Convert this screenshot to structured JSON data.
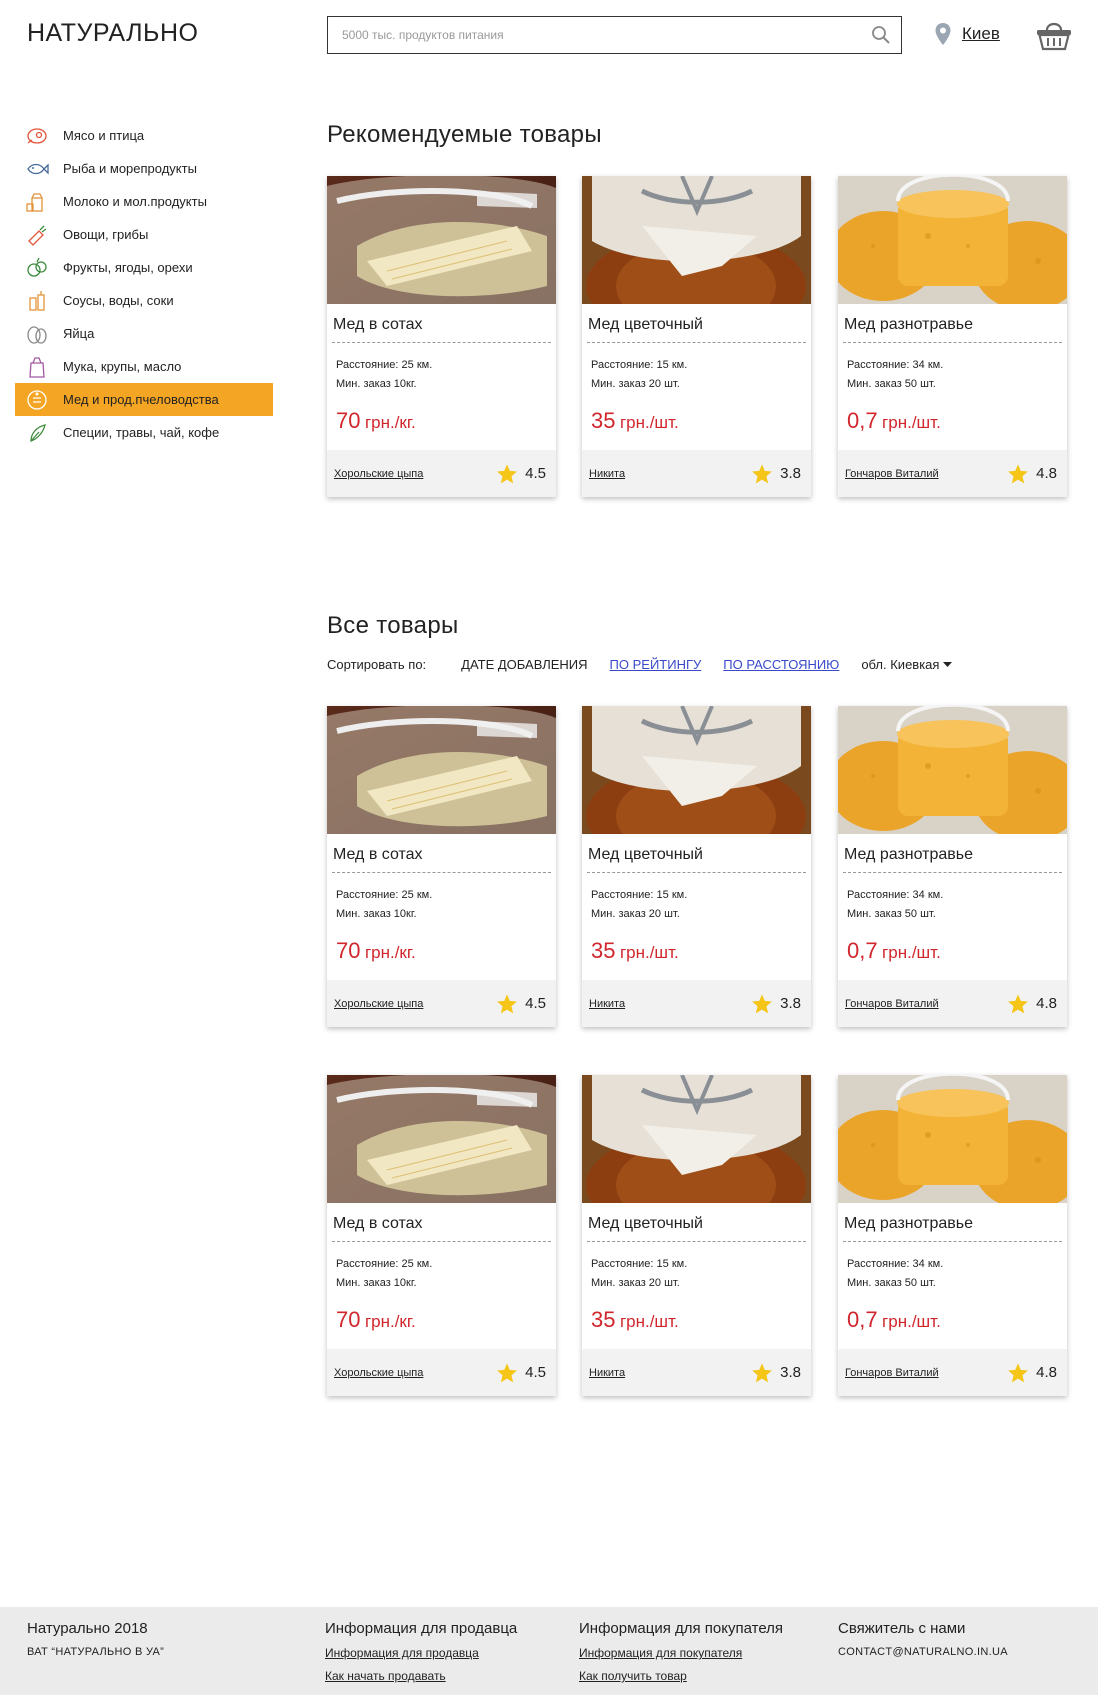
{
  "header": {
    "logo": "НАТУРАЛЬНО",
    "search_placeholder": "5000 тыс. продуктов питания",
    "city": "Киев"
  },
  "sidebar": {
    "items": [
      {
        "label": "Мясо и птица",
        "icon": "meat-icon",
        "active": false
      },
      {
        "label": "Рыба и морепродукты",
        "icon": "fish-icon",
        "active": false
      },
      {
        "label": "Молоко и мол.продукты",
        "icon": "milk-icon",
        "active": false
      },
      {
        "label": "Овощи, грибы",
        "icon": "vegetables-icon",
        "active": false
      },
      {
        "label": "Фрукты, ягоды, орехи",
        "icon": "fruits-icon",
        "active": false
      },
      {
        "label": "Соусы, воды, соки",
        "icon": "drinks-icon",
        "active": false
      },
      {
        "label": "Яйца",
        "icon": "eggs-icon",
        "active": false
      },
      {
        "label": "Мука, крупы, масло",
        "icon": "flour-icon",
        "active": false
      },
      {
        "label": "Мед и прод.пчеловодства",
        "icon": "honey-icon",
        "active": true
      },
      {
        "label": "Специи, травы, чай, кофе",
        "icon": "herbs-icon",
        "active": false
      }
    ]
  },
  "recommended": {
    "title": "Рекомендуемые товары"
  },
  "all": {
    "title": "Все товары",
    "sort_label": "Сортировать по:",
    "sort_options": [
      "дате добавления",
      "по рейтингу",
      "по расстоянию"
    ],
    "region": "обл. Киевкая"
  },
  "products": [
    {
      "name": "Мед в сотах",
      "distance": "Расстояние: 25 км.",
      "min_order": "Мин. заказ 10кг.",
      "price": "70",
      "unit": "грн./кг.",
      "seller": "Хорольские цыпа",
      "rating": "4.5",
      "image": "honeycomb-bucket"
    },
    {
      "name": "Мед цветочный",
      "distance": "Расстояние: 15 км.",
      "min_order": "Мин. заказ 20 шт.",
      "price": "35",
      "unit": "грн./шт.",
      "seller": "Никита",
      "rating": "3.8",
      "image": "honey-jar"
    },
    {
      "name": "Мед разнотравье",
      "distance": "Расстояние: 34 км.",
      "min_order": "Мин. заказ 50 шт.",
      "price": "0,7",
      "unit": "грн./шт.",
      "seller": "Гончаров Виталий",
      "rating": "4.8",
      "image": "honey-buckets"
    }
  ],
  "footer": {
    "brand": "Натурально 2018",
    "brand_sub": "ВАТ “Натурально в уа”",
    "seller_title": "Информация для продавца",
    "seller_links": [
      "Информация для продавца",
      "Как начать продавать"
    ],
    "buyer_title": "Информация для покупателя",
    "buyer_links": [
      "Информация для покупателя",
      "Как получить товар"
    ],
    "contact_title": "Свяжитель с нами",
    "email": "contact@naturalno.in.ua"
  },
  "colors": {
    "accent": "#f5a524",
    "price": "#d0262c",
    "link": "#3949c9",
    "star": "#f5c518"
  }
}
